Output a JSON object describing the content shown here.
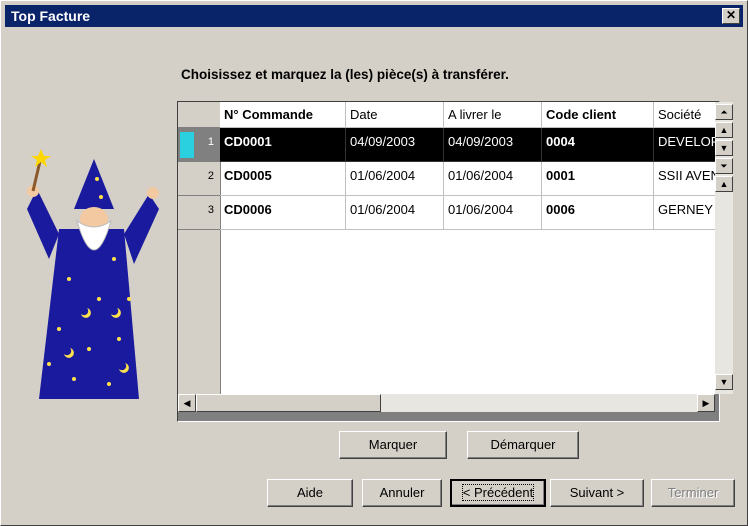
{
  "window": {
    "title": "Top Facture",
    "close_glyph": "✕"
  },
  "instruction": "Choisissez et marquez la (les) pièce(s) à transférer.",
  "grid": {
    "columns": [
      "N° Commande",
      "Date",
      "A livrer le",
      "Code client",
      "Société"
    ],
    "rows": [
      {
        "num": "1",
        "commande": "CD0001",
        "date": "04/09/2003",
        "livrer": "04/09/2003",
        "client": "0004",
        "societe": "DEVELOPPEMENT"
      },
      {
        "num": "2",
        "commande": "CD0005",
        "date": "01/06/2004",
        "livrer": "01/06/2004",
        "client": "0001",
        "societe": "SSII AVENIR"
      },
      {
        "num": "3",
        "commande": "CD0006",
        "date": "01/06/2004",
        "livrer": "01/06/2004",
        "client": "0006",
        "societe": "GERNEY"
      }
    ],
    "selected_row": 1
  },
  "buttons": {
    "marquer": "Marquer",
    "demarquer": "Démarquer",
    "aide": "Aide",
    "annuler": "Annuler",
    "precedent": "< Précédent",
    "suivant": "Suivant >",
    "terminer": "Terminer"
  },
  "scroll": {
    "first": "⏶",
    "up": "▲",
    "down": "▼",
    "last": "⏷",
    "left": "◀",
    "right": "▶"
  },
  "colors": {
    "titlebar": "#0a246a",
    "selection": "#000000",
    "cursor": "#2ad0e0",
    "face": "#d4d0c8"
  }
}
